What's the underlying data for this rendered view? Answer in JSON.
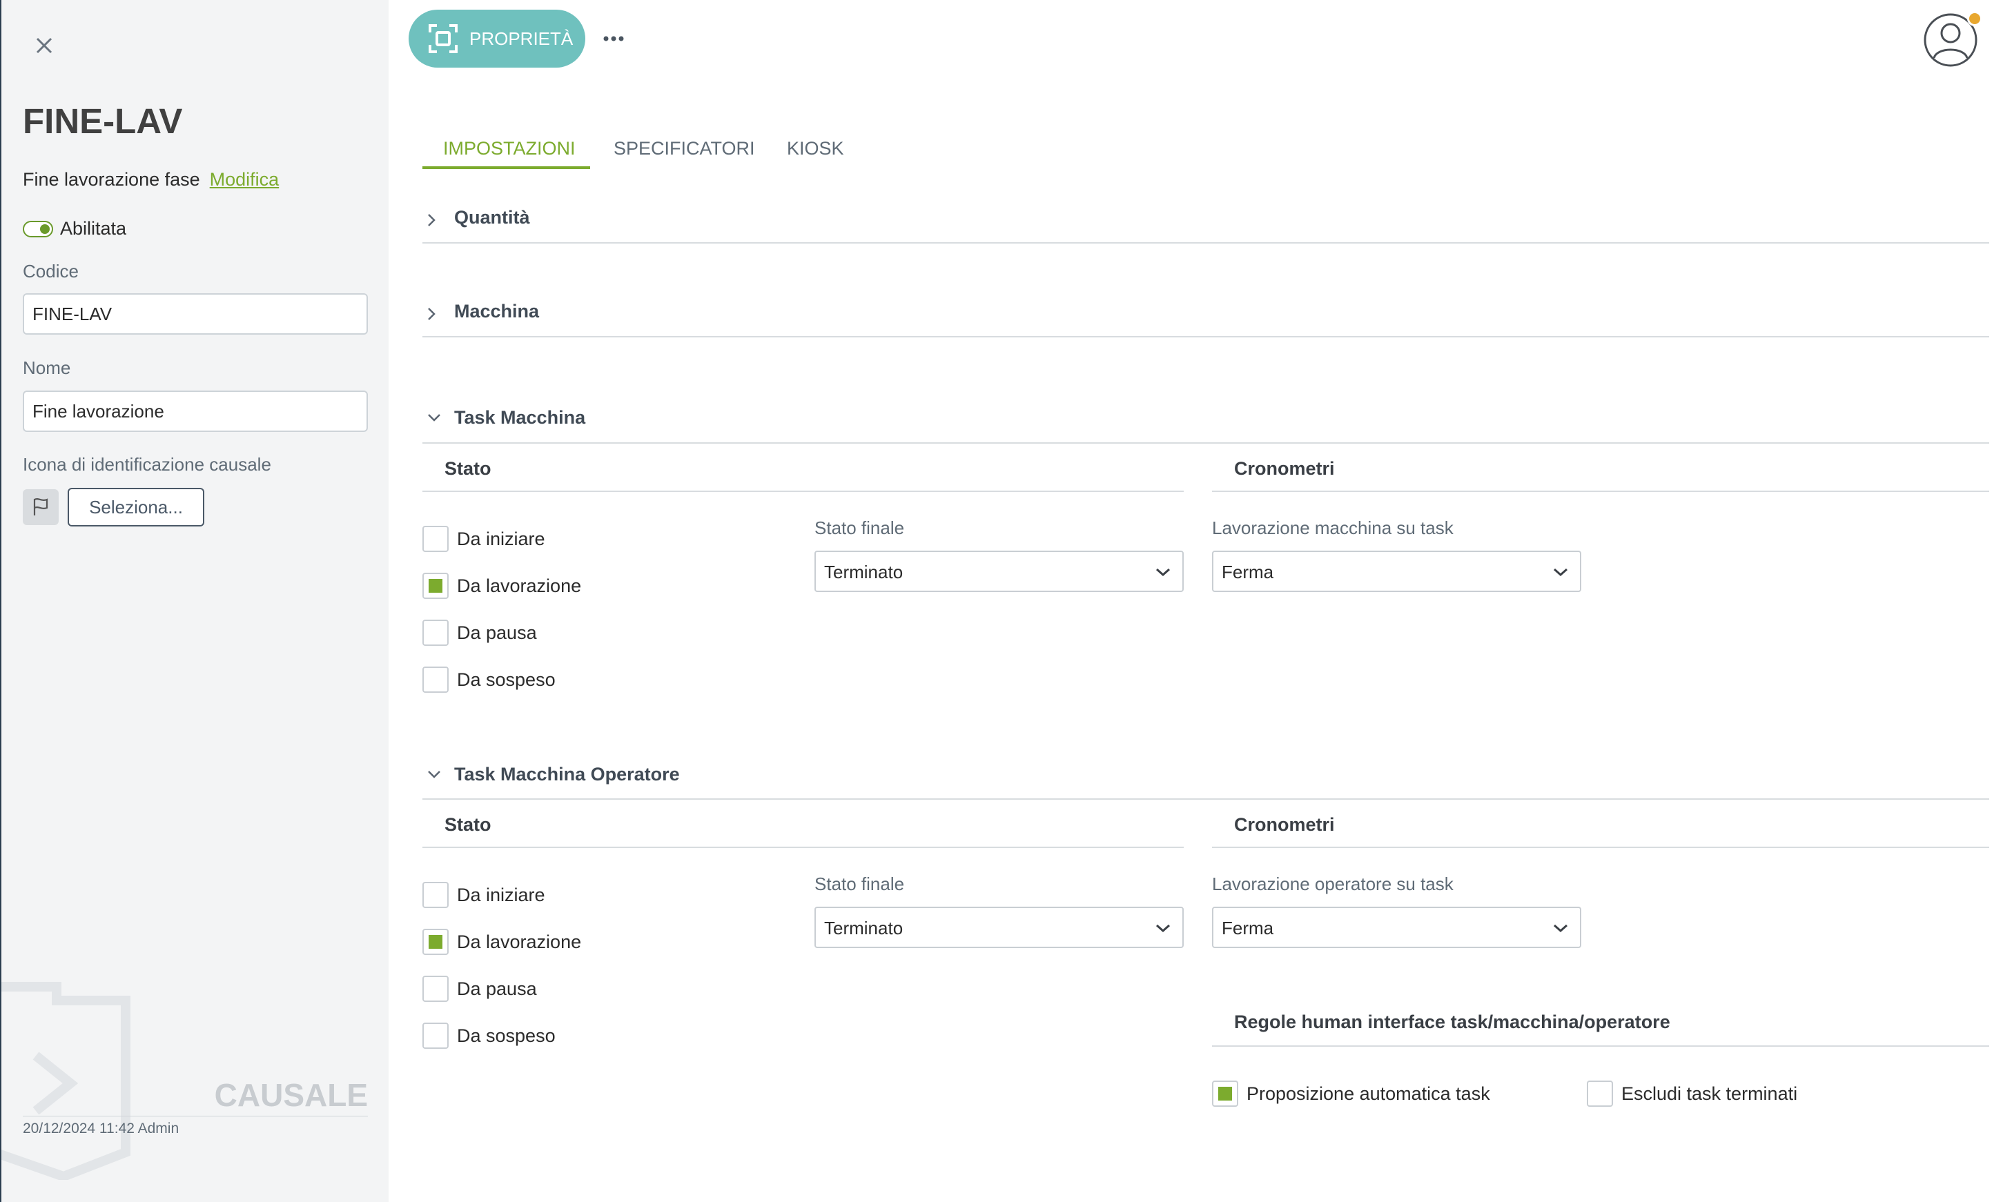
{
  "sidebar": {
    "record_code": "FINE-LAV",
    "description": "Fine lavorazione fase",
    "edit_link": "Modifica",
    "enabled_label": "Abilitata",
    "code_label": "Codice",
    "code_value": "FINE-LAV",
    "name_label": "Nome",
    "name_value": "Fine lavorazione",
    "icon_label": "Icona di identificazione causale",
    "select_button": "Seleziona...",
    "watermark": "CAUSALE",
    "footer_meta": "20/12/2024 11:42 Admin"
  },
  "topbar": {
    "properties_button": "PROPRIETÀ",
    "accent_color": "#6fc1be"
  },
  "tabs": [
    {
      "label": "IMPOSTAZIONI",
      "active": true
    },
    {
      "label": "SPECIFICATORI",
      "active": false
    },
    {
      "label": "KIOSK",
      "active": false
    }
  ],
  "sections": {
    "quantita": {
      "title": "Quantità",
      "expanded": false
    },
    "macchina": {
      "title": "Macchina",
      "expanded": false
    },
    "task_macchina": {
      "title": "Task Macchina",
      "expanded": true,
      "stato_header": "Stato",
      "cronometri_header": "Cronometri",
      "checkboxes": [
        {
          "label": "Da iniziare",
          "checked": false
        },
        {
          "label": "Da lavorazione",
          "checked": true
        },
        {
          "label": "Da pausa",
          "checked": false
        },
        {
          "label": "Da sospeso",
          "checked": false
        }
      ],
      "final_state_label": "Stato finale",
      "final_state_value": "Terminato",
      "timer_label": "Lavorazione macchina su task",
      "timer_value": "Ferma"
    },
    "task_macchina_operatore": {
      "title": "Task Macchina Operatore",
      "expanded": true,
      "stato_header": "Stato",
      "cronometri_header": "Cronometri",
      "checkboxes": [
        {
          "label": "Da iniziare",
          "checked": false
        },
        {
          "label": "Da lavorazione",
          "checked": true
        },
        {
          "label": "Da pausa",
          "checked": false
        },
        {
          "label": "Da sospeso",
          "checked": false
        }
      ],
      "final_state_label": "Stato finale",
      "final_state_value": "Terminato",
      "timer_label": "Lavorazione operatore su task",
      "timer_value": "Ferma",
      "rules_header": "Regole human interface task/macchina/operatore",
      "rules": [
        {
          "label": "Proposizione automatica task",
          "checked": true
        },
        {
          "label": "Escludi task terminati",
          "checked": false
        }
      ]
    }
  },
  "colors": {
    "accent_green": "#7cab2e",
    "sidebar_bg": "#f3f4f5",
    "notification_badge": "#e8a72f"
  }
}
